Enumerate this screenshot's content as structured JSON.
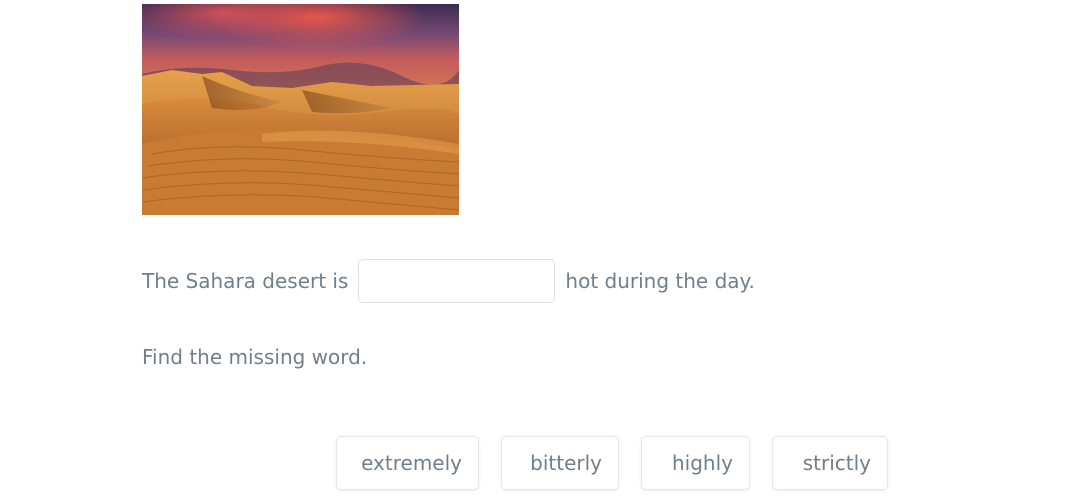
{
  "exercise": {
    "image": "sahara-desert-dunes-sunset-photo",
    "sentence_before": "The Sahara desert is",
    "sentence_after": "hot during the day.",
    "blank_value": "",
    "instruction": "Find the missing word.",
    "choices": [
      "extremely",
      "bitterly",
      "highly",
      "strictly"
    ]
  },
  "colors": {
    "text": "#6f7f8b",
    "border": "#dfe3e7",
    "background": "#ffffff"
  }
}
